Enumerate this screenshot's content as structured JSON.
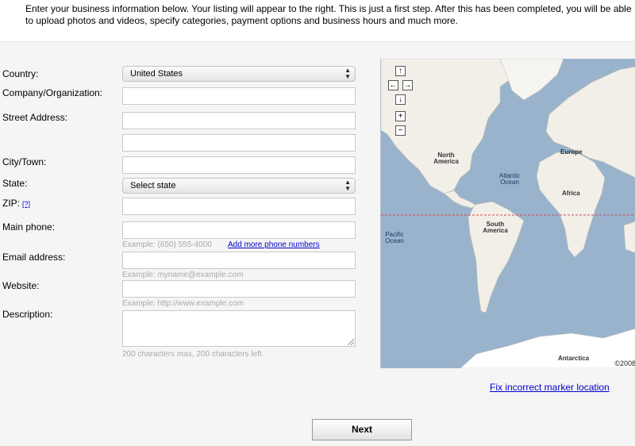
{
  "intro": "Enter your business information below. Your listing will appear to the right. This is just a first step. After this has been completed, you will be able to upload photos and videos, specify categories, payment options and business hours and much more.",
  "form": {
    "country_label": "Country:",
    "country_value": "United States",
    "company_label": "Company/Organization:",
    "street_label": "Street Address:",
    "city_label": "City/Town:",
    "state_label": "State:",
    "state_value": "Select state",
    "zip_label": "ZIP:",
    "zip_help": "[?]",
    "phone_label": "Main phone:",
    "phone_hint": "Example: (650) 555-4000",
    "add_phone_link": "Add more phone numbers",
    "email_label": "Email address:",
    "email_hint": "Example: myname@example.com",
    "website_label": "Website:",
    "website_hint": "Example: http://www.example.com",
    "description_label": "Description:",
    "description_hint": "200 characters max, 200 characters left."
  },
  "map": {
    "controls": {
      "up": "↑",
      "left": "←",
      "right": "→",
      "down": "↓",
      "zoom_in": "+",
      "zoom_out": "−"
    },
    "labels": {
      "north_america": "North America",
      "europe": "Europe",
      "atlantic_ocean": "Atlantic Ocean",
      "africa": "Africa",
      "pacific_ocean": "Pacific Ocean",
      "south_america": "South America",
      "antarctica": "Antarctica"
    },
    "copyright": "©2008",
    "colors": {
      "water": "#99b3cc",
      "land": "#f2efe9",
      "equator": "#d24b4b"
    }
  },
  "fix_marker_link": "Fix incorrect marker location",
  "next_button": "Next"
}
